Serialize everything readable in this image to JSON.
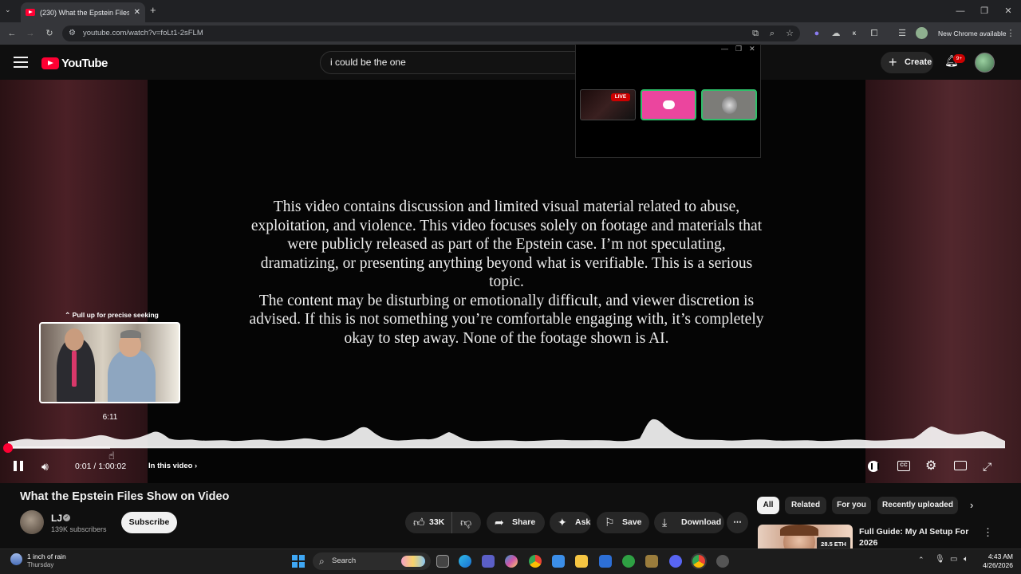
{
  "browser": {
    "tab_title": "(230) What the Epstein Files Show on Video",
    "url": "youtube.com/watch?v=foLt1-2sFLM",
    "new_chrome_label": "New Chrome available"
  },
  "header": {
    "logo_text": "YouTube",
    "search_value": "i could be the one",
    "create_label": "Create",
    "notification_count": "9+"
  },
  "floating_window": {
    "live_badge": "LIVE"
  },
  "player": {
    "disclaimer": "This video contains discussion and limited visual material related to abuse,\nexploitation, and violence. This video focuses solely on footage and materials that\nwere publicly released as part of the Epstein case. I’m not speculating,\ndramatizing, or presenting anything beyond what is verifiable. This is a serious\ntopic.\nThe content may be disturbing or emotionally difficult, and viewer discretion is\nadvised. If this is not something you’re comfortable engaging with, it’s completely\nokay to step away. None of the footage shown is AI.",
    "seek_hint": "⌃ Pull up for precise seeking",
    "preview_time": "6:11",
    "time_display": "0:01 / 1:00:02",
    "in_this_video": "In this video ›",
    "cc_label": "CC",
    "progress_fraction": 0.0003
  },
  "video_info": {
    "title": "What the Epstein Files Show on Video",
    "channel_name": "LJ",
    "subscribers": "139K subscribers",
    "subscribe_label": "Subscribe",
    "likes": "33K",
    "share_label": "Share",
    "ask_label": "Ask",
    "save_label": "Save",
    "download_label": "Download"
  },
  "chips": [
    "All",
    "Related",
    "For you",
    "Recently uploaded"
  ],
  "recommendation": {
    "title": "Full Guide: My AI Setup For 2026",
    "thumb_badge": "28.5 ETH"
  },
  "taskbar": {
    "weather_main": "1 inch of rain",
    "weather_sub": "Thursday",
    "search_label": "Search",
    "time": "4:43 AM",
    "date": "4/26/2026"
  },
  "colors": {
    "accent_red": "#ff0033",
    "background": "#0f0f0f",
    "discord_pink": "#eb459e"
  }
}
